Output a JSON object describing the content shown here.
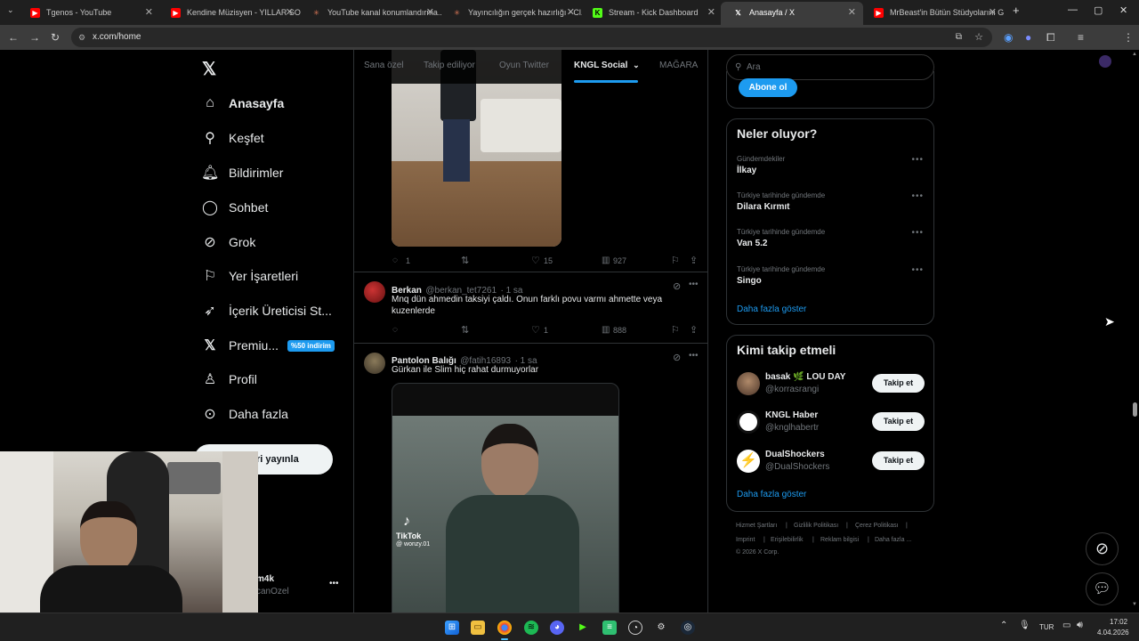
{
  "browser": {
    "tabs": [
      {
        "title": "Tgenos - YouTube",
        "favicon": "youtube-icon"
      },
      {
        "title": "Kendine Müzisyen - YILLAR SO...",
        "favicon": "youtube-icon"
      },
      {
        "title": "YouTube kanal konumlandırma...",
        "favicon": "claude-icon"
      },
      {
        "title": "Yayıncılığın gerçek hazırlığı - Cl...",
        "favicon": "claude-icon"
      },
      {
        "title": "Stream - Kick Dashboard",
        "favicon": "kick-icon"
      },
      {
        "title": "Anasayfa / X",
        "favicon": "x-icon"
      },
      {
        "title": "MrBeast'in Bütün Stüdyolarını G...",
        "favicon": "youtube-icon"
      }
    ],
    "url": "x.com/home"
  },
  "sidebar": {
    "items": [
      {
        "label": "Anasayfa",
        "icon": "home-icon"
      },
      {
        "label": "Keşfet",
        "icon": "search-icon"
      },
      {
        "label": "Bildirimler",
        "icon": "bell-icon"
      },
      {
        "label": "Sohbet",
        "icon": "chat-icon"
      },
      {
        "label": "Grok",
        "icon": "grok-icon"
      },
      {
        "label": "Yer İşaretleri",
        "icon": "bookmark-icon"
      },
      {
        "label": "İçerik Üreticisi St...",
        "icon": "rocket-icon"
      },
      {
        "label": "Premiu...",
        "icon": "x-icon"
      },
      {
        "label": "Profil",
        "icon": "person-icon"
      },
      {
        "label": "Daha fazla",
        "icon": "more-circle-icon"
      }
    ],
    "premium_badge": "%50 indirim",
    "post_button": "ri yayınla",
    "account_name": "m4k",
    "account_handle": "canOzel"
  },
  "feed": {
    "tabs": [
      "Sana özel",
      "Takip ediliyor",
      "Oyun Twitter",
      "KNGL Social",
      "MAĞARA"
    ],
    "active_tab": "KNGL Social",
    "posts": [
      {
        "replies": "1",
        "likes": "15",
        "views": "927"
      },
      {
        "name": "Berkan",
        "handle": "@berkan_tet7261",
        "time": "· 1 sa",
        "text": "Mnq dün ahmedin taksiyi çaldı. Onun farklı povu varmı ahmette veya kuzenlerde",
        "replies": "",
        "likes": "1",
        "views": "888"
      },
      {
        "name": "Pantolon Balığı",
        "handle": "@fatih16893",
        "time": "· 1 sa",
        "text": "Gürkan ile Slim hiç rahat durmuyorlar",
        "video_watermark": "TikTok",
        "video_user": "@ wonzy.01"
      }
    ]
  },
  "right": {
    "search_placeholder": "Ara",
    "subscribe_button": "Abone ol",
    "trends_title": "Neler oluyor?",
    "trends": [
      {
        "meta": "Gündemdekiler",
        "name": "İlkay"
      },
      {
        "meta": "Türkiye tarihinde gündemde",
        "name": "Dilara Kırmıt"
      },
      {
        "meta": "Türkiye tarihinde gündemde",
        "name": "Van 5.2"
      },
      {
        "meta": "Türkiye tarihinde gündemde",
        "name": "Singo"
      }
    ],
    "show_more": "Daha fazla göster",
    "who_title": "Kimi takip etmeli",
    "who": [
      {
        "name": "basak 🌿 LOU DAY",
        "handle": "@korrasrangi"
      },
      {
        "name": "KNGL Haber",
        "handle": "@knglhabertr"
      },
      {
        "name": "DualShockers",
        "handle": "@DualShockers"
      }
    ],
    "follow_label": "Takip et",
    "footer_links": [
      "Hizmet Şartları",
      "Gizlilik Politikası",
      "Çerez Politikası",
      "Imprint",
      "Erişilebilirlik",
      "Reklam bilgisi",
      "Daha fazla ..."
    ],
    "copyright": "© 2026 X Corp."
  },
  "taskbar": {
    "language": "TUR",
    "time": "17:02",
    "date": "4.04.2026"
  }
}
